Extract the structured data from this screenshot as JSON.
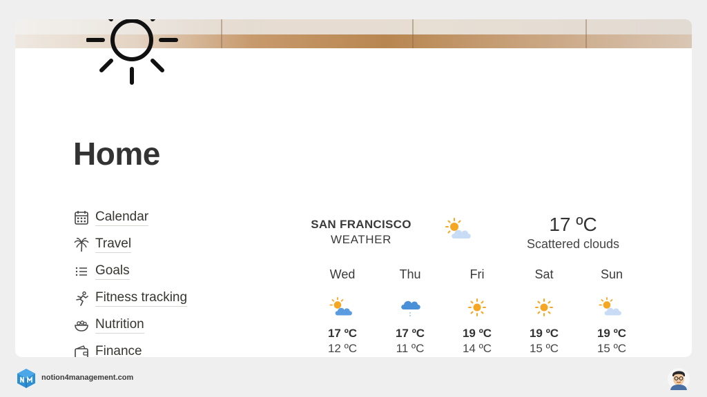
{
  "page": {
    "title": "Home"
  },
  "nav": {
    "items": [
      {
        "label": "Calendar",
        "icon": "calendar-icon"
      },
      {
        "label": "Travel",
        "icon": "palm-tree-icon"
      },
      {
        "label": "Goals",
        "icon": "list-icon"
      },
      {
        "label": "Fitness tracking",
        "icon": "running-person-icon"
      },
      {
        "label": "Nutrition",
        "icon": "food-bowl-icon"
      },
      {
        "label": "Finance",
        "icon": "wallet-icon"
      }
    ]
  },
  "weather": {
    "city": "SAN FRANCISCO",
    "subtitle": "WEATHER",
    "current_temp": "17 ºC",
    "current_desc": "Scattered clouds",
    "current_icon": "sun-behind-cloud-icon",
    "forecast": [
      {
        "day": "Wed",
        "high": "17 ºC",
        "low": "12 ºC",
        "icon": "sun-behind-cloud-icon"
      },
      {
        "day": "Thu",
        "high": "17 ºC",
        "low": "11 ºC",
        "icon": "rain-cloud-icon"
      },
      {
        "day": "Fri",
        "high": "19 ºC",
        "low": "14 ºC",
        "icon": "sun-icon"
      },
      {
        "day": "Sat",
        "high": "19 ºC",
        "low": "15 ºC",
        "icon": "sun-icon"
      },
      {
        "day": "Sun",
        "high": "19 ºC",
        "low": "15 ºC",
        "icon": "sun-behind-cloud-icon"
      }
    ]
  },
  "footer": {
    "site": "notion4management.com"
  },
  "colors": {
    "sun": "#f5a623",
    "cloud": "#8fb4e8",
    "rain_cloud": "#4a90d9"
  }
}
